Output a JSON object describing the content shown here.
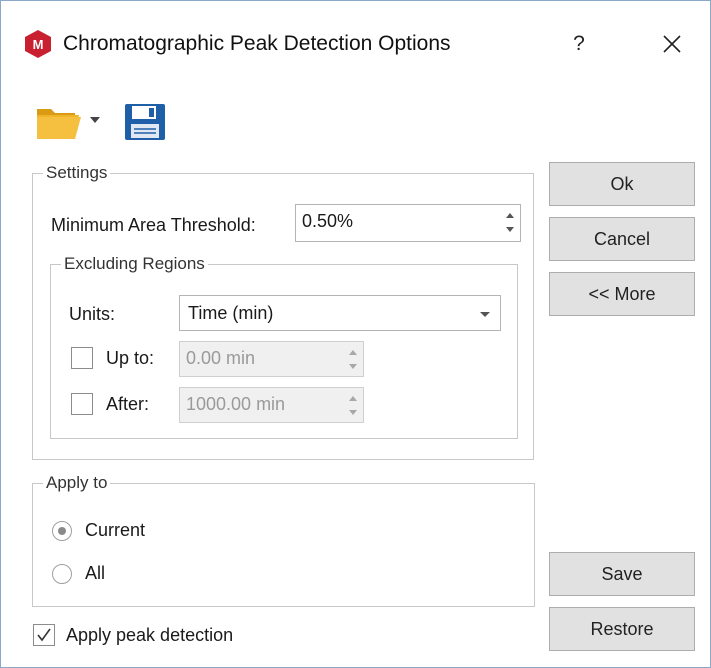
{
  "window": {
    "title": "Chromatographic Peak Detection Options",
    "help": "?"
  },
  "settings": {
    "legend": "Settings",
    "min_area_label": "Minimum Area Threshold:",
    "min_area_value": "0.50%",
    "excluding": {
      "legend": "Excluding Regions",
      "units_label": "Units:",
      "units_value": "Time (min)",
      "up_to_label": "Up to:",
      "up_to_value": "0.00 min",
      "up_to_checked": false,
      "after_label": "After:",
      "after_value": "1000.00 min",
      "after_checked": false
    }
  },
  "apply_to": {
    "legend": "Apply to",
    "options": [
      {
        "label": "Current",
        "selected": true
      },
      {
        "label": "All",
        "selected": false
      }
    ]
  },
  "apply_peak": {
    "label": "Apply peak detection",
    "checked": true
  },
  "buttons": {
    "ok": "Ok",
    "cancel": "Cancel",
    "more": "<< More",
    "save": "Save",
    "restore": "Restore"
  },
  "icons": {
    "app": "app-logo-icon",
    "open": "folder-open-icon",
    "open_menu": "dropdown-arrow-icon",
    "save": "floppy-disk-icon",
    "close": "close-icon"
  },
  "colors": {
    "app_icon": "#c8202f",
    "folder": "#f0b428",
    "floppy": "#1f5fa8",
    "button_face": "#e1e1e1"
  }
}
